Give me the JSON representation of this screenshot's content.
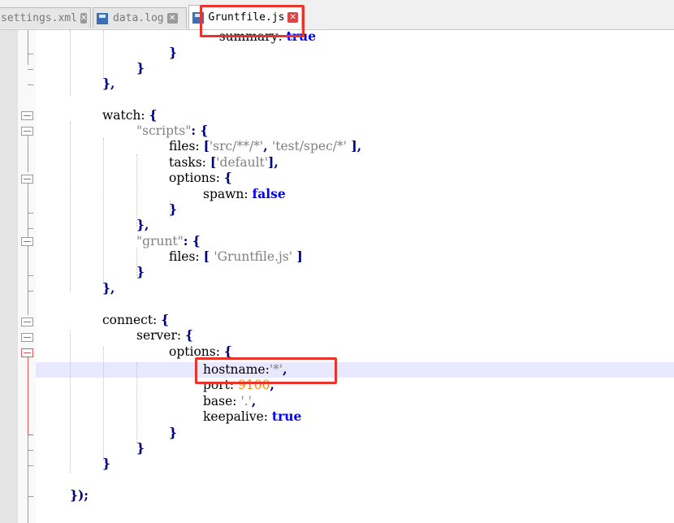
{
  "tabs": [
    {
      "label": "settings.xml",
      "active": false
    },
    {
      "label": "data.log",
      "active": false
    },
    {
      "label": "Gruntfile.js",
      "active": true
    }
  ],
  "colors": {
    "keyword": "#0000ff",
    "punctuation": "#000080",
    "string": "#808080",
    "number": "#ff8000",
    "highlight": "#e8e8ff",
    "annotation": "#e8352c"
  },
  "code": {
    "l0": {
      "a": "    summary: ",
      "b": "true"
    },
    "l1": {
      "a": "}"
    },
    "l2": {
      "a": "}"
    },
    "l3": {
      "a": "},"
    },
    "l4": {
      "a": "watch: ",
      "b": "{"
    },
    "l5": {
      "a": "\"scripts\"",
      "b": ": {"
    },
    "l6": {
      "a": "files: ",
      "b": "[",
      "c": "'src/**/*'",
      "d": ", ",
      "e": "'test/spec/*'",
      "f": " ],"
    },
    "l7": {
      "a": "tasks: ",
      "b": "[",
      "c": "'default'",
      "d": "],"
    },
    "l8": {
      "a": "options: ",
      "b": "{"
    },
    "l9": {
      "a": "spawn: ",
      "b": "false"
    },
    "l10": {
      "a": "}"
    },
    "l11": {
      "a": "},"
    },
    "l12": {
      "a": "\"grunt\"",
      "b": ": {"
    },
    "l13": {
      "a": "files: ",
      "b": "[ ",
      "c": "'Gruntfile.js'",
      "d": " ]"
    },
    "l14": {
      "a": "}"
    },
    "l15": {
      "a": "},"
    },
    "l16": {
      "a": "connect: ",
      "b": "{"
    },
    "l17": {
      "a": "server: ",
      "b": "{"
    },
    "l18": {
      "a": "options: ",
      "b": "{"
    },
    "l19": {
      "a": "hostname:",
      "b": "'*'",
      "c": ","
    },
    "l20": {
      "a": "port: ",
      "b": "9100",
      "c": ","
    },
    "l21": {
      "a": "base: ",
      "b": "'.'",
      "c": ","
    },
    "l22": {
      "a": "keepalive: ",
      "b": "true"
    },
    "l23": {
      "a": "}"
    },
    "l24": {
      "a": "}"
    },
    "l25": {
      "a": "}"
    },
    "l26": {
      "a": "});"
    }
  }
}
